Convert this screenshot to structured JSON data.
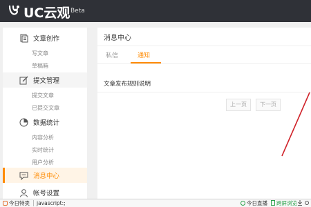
{
  "app": {
    "brand": "UC云观",
    "badge": "Beta"
  },
  "sidebar": {
    "sections": [
      {
        "label": "文章创作",
        "icon": "document-icon",
        "subs": [
          "写文章",
          "草稿箱"
        ]
      },
      {
        "label": "提文管理",
        "icon": "edit-icon",
        "subs": [
          "提交文章",
          "已提交文章"
        ]
      },
      {
        "label": "数据统计",
        "icon": "chart-icon",
        "subs": [
          "内容分析",
          "实时统计",
          "用户分析"
        ]
      },
      {
        "label": "消息中心",
        "icon": "message-icon",
        "subs": []
      },
      {
        "label": "帐号设置",
        "icon": "account-icon",
        "subs": []
      }
    ],
    "active": "消息中心"
  },
  "main": {
    "title": "消息中心",
    "tabs": [
      "私信",
      "通知"
    ],
    "active_tab": "通知",
    "notice": "文章发布规则说明",
    "prev": "上一页",
    "next": "下一页"
  },
  "statusbar": {
    "left1": "今日特卖",
    "left2": "javascript:;",
    "right1": "今日直播",
    "right2": "跨屏浏览"
  },
  "colors": {
    "accent": "#ff8a00",
    "topbar": "#2f3137",
    "arrow": "#d0232a"
  }
}
